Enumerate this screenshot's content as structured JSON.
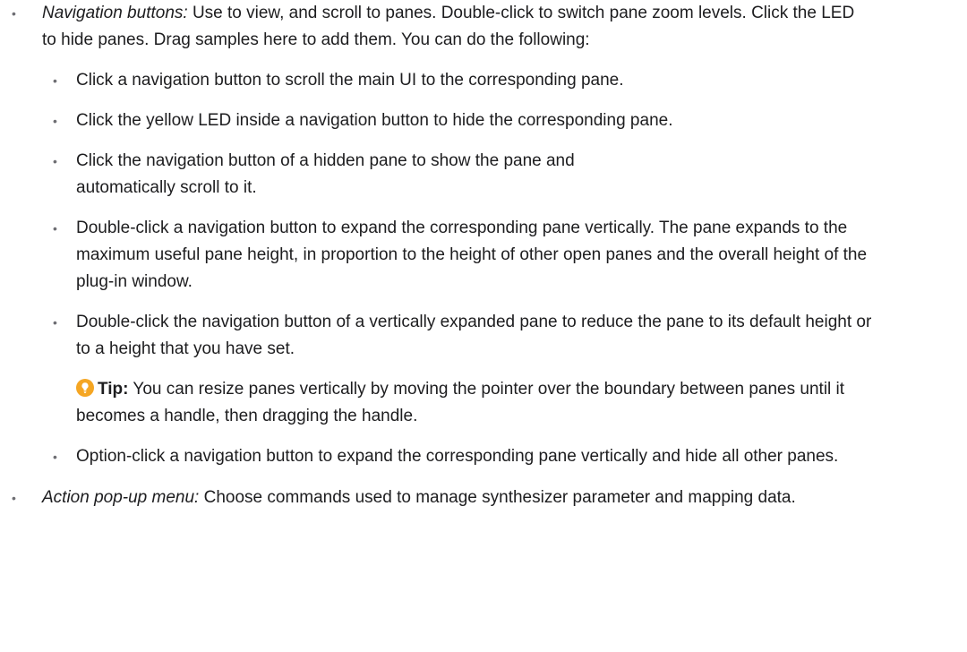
{
  "colors": {
    "text": "#1d1d1f",
    "bullet": "#6e6e73",
    "tip_icon": "#f5a623"
  },
  "bullet_glyph": "•",
  "items": [
    {
      "term": "Navigation buttons:",
      "text": " Use to view, and scroll to panes. Double-click to switch pane zoom levels. Click the LED to hide panes. Drag samples here to add them. You can do the following:",
      "subitems": [
        "Click a navigation button to scroll the main UI to the corresponding pane.",
        "Click the yellow LED inside a navigation button to hide the corresponding pane.",
        "Click the navigation button of a hidden pane to show the pane and automatically scroll to it.",
        "Double-click a navigation button to expand the corresponding pane vertically. The pane expands to the maximum useful pane height, in proportion to the height of other open panes and the overall height of the plug-in window.",
        "Double-click the navigation button of a vertically expanded pane to reduce the pane to its default height or to a height that you have set.",
        "Option-click a navigation button to expand the corresponding pane vertically and hide all other panes."
      ],
      "tip": {
        "icon": "lightbulb-icon",
        "label": "Tip:",
        "text": " You can resize panes vertically by moving the pointer over the boundary between panes until it becomes a handle, then dragging the handle."
      }
    },
    {
      "term": "Action pop-up menu:",
      "text": " Choose commands used to manage synthesizer parameter and mapping data."
    }
  ]
}
